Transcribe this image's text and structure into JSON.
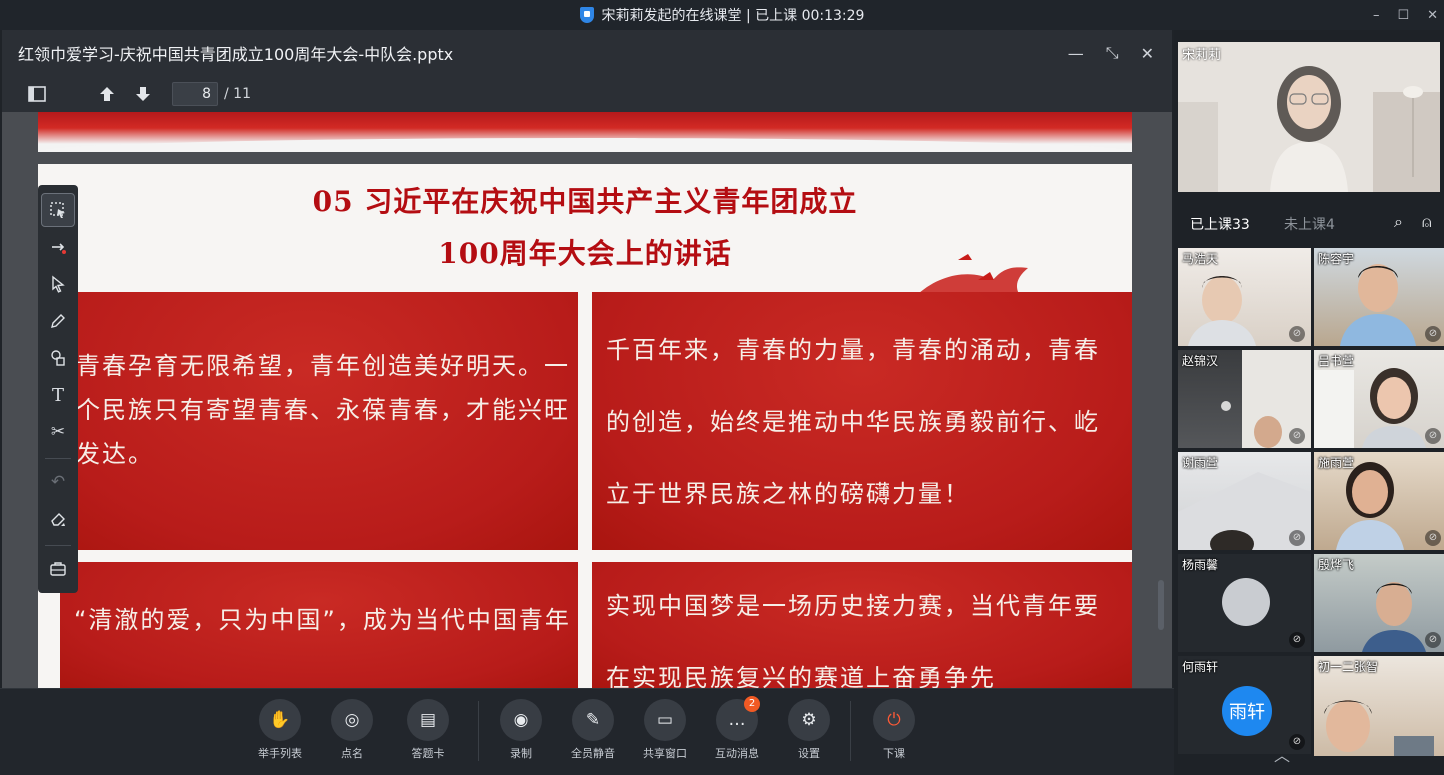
{
  "titlebar": {
    "text": "宋莉莉发起的在线课堂 | 已上课 00:13:29",
    "min": "–",
    "max": "☐",
    "close": "✕"
  },
  "doc": {
    "filename": "红领巾爱学习-庆祝中国共青团成立100周年大会-中队会.pptx",
    "ctl_min": "—",
    "ctl_restore": "⤡",
    "ctl_close": "✕",
    "page_current": "8",
    "page_total": "/ 11"
  },
  "slide": {
    "title_line1": "05  习近平在庆祝中国共产主义青年团成立",
    "title_line2": "100周年大会上的讲话",
    "card1": [
      "青春孕育无限希望，青年创造美好明天。一",
      "个民族只有寄望青春、永葆青春，才能兴旺",
      "发达。"
    ],
    "card2": [
      "千百年来，青春的力量，青春的涌动，青春",
      "的创造，始终是推动中华民族勇毅前行、屹",
      "立于世界民族之林的磅礴力量！"
    ],
    "card3": [
      "“清澈的爱，只为中国”，成为当代中国青年"
    ],
    "card4": [
      "实现中国梦是一场历史接力赛，当代青年要",
      "在实现民族复兴的赛道上奋勇争先"
    ]
  },
  "bottombar": {
    "buttons": [
      {
        "label": "举手列表",
        "icon": "✋"
      },
      {
        "label": "点名",
        "icon": "◎"
      },
      {
        "label": "答题卡",
        "icon": "▤"
      },
      {
        "label": "录制",
        "icon": "◉"
      },
      {
        "label": "全员静音",
        "icon": "✎"
      },
      {
        "label": "共享窗口",
        "icon": "▭"
      },
      {
        "label": "互动消息",
        "icon": "…",
        "badge": "2"
      },
      {
        "label": "设置",
        "icon": "⚙"
      },
      {
        "label": "下课",
        "icon": "⏻"
      }
    ]
  },
  "right": {
    "teacher_name": "宋莉莉",
    "tab_attended": "已上课33",
    "tab_absent": "未上课4",
    "search_icon": "⌕",
    "adduser_icon": "⍝",
    "students": [
      {
        "name": "马浩天"
      },
      {
        "name": "陈容宇"
      },
      {
        "name": "赵锦汉"
      },
      {
        "name": "吕书萱"
      },
      {
        "name": "谢雨萱"
      },
      {
        "name": "施雨萱"
      },
      {
        "name": "杨雨馨"
      },
      {
        "name": "殷烨飞"
      },
      {
        "name": "何雨轩",
        "avatar_text": "雨轩"
      },
      {
        "name": "初一二张智"
      }
    ],
    "chevron": "︿"
  },
  "colors": {
    "slide_red": "#c0211d",
    "title_red": "#b40d12",
    "accent_blue": "#1e88f0",
    "badge": "#f15a24"
  }
}
